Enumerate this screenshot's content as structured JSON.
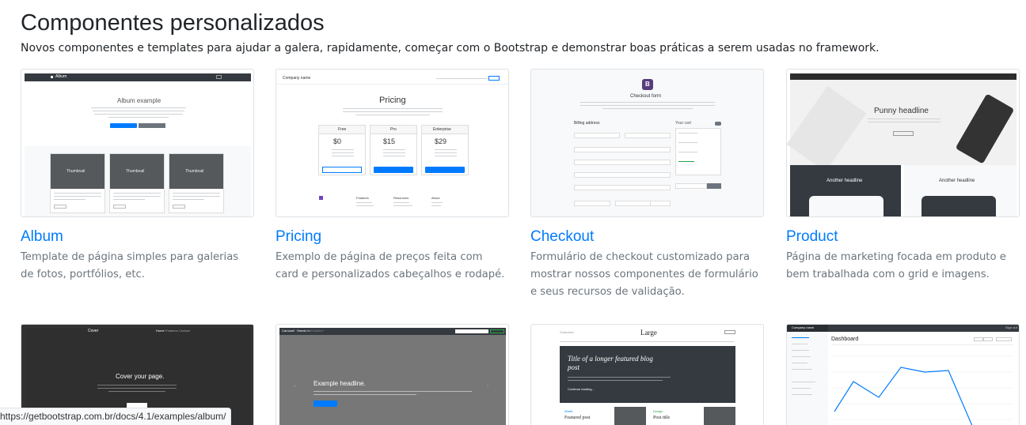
{
  "section": {
    "title": "Componentes personalizados",
    "lead": "Novos componentes e templates para ajudar a galera, rapidamente, começar com o Bootstrap e demonstrar boas práticas a serem usadas no framework."
  },
  "examples": [
    {
      "title": "Album",
      "description": "Template de página simples para galerias de fotos, portfólios, etc."
    },
    {
      "title": "Pricing",
      "description": "Exemplo de página de preços feita com card e personalizados cabeçalhos e rodapé."
    },
    {
      "title": "Checkout",
      "description": "Formulário de checkout customizado para mostrar nossos componentes de formulário e seus recursos de validação."
    },
    {
      "title": "Product",
      "description": "Página de marketing focada em produto e bem trabalhada com o grid e imagens."
    }
  ],
  "thumbs": {
    "album": {
      "brand": "Album",
      "heading": "Album example",
      "thumb_label": "Thumbnail"
    },
    "pricing": {
      "company": "Company name",
      "heading": "Pricing",
      "plans": [
        {
          "name": "Free",
          "price": "$0",
          "per": "/ mo",
          "cta": "Sign up for free"
        },
        {
          "name": "Pro",
          "price": "$15",
          "per": "/ mo",
          "cta": "Get started"
        },
        {
          "name": "Enterprise",
          "price": "$29",
          "per": "/ mo",
          "cta": "Contact us"
        }
      ],
      "footer": [
        "Features",
        "Resources",
        "About"
      ]
    },
    "checkout": {
      "logo": "B",
      "heading": "Checkout form",
      "billing": "Billing address",
      "cart": "Your cart",
      "cart_count": "3"
    },
    "product": {
      "heading": "Punny headline",
      "headline_left": "Another headline",
      "headline_right": "Another headline"
    },
    "cover": {
      "brand": "Cover",
      "nav": [
        "Home",
        "Features",
        "Contact"
      ],
      "heading": "Cover your page.",
      "cta": "Learn more"
    },
    "carousel": {
      "brand": "Carousel",
      "nav": [
        "Home",
        "Link",
        "Disabled"
      ],
      "heading": "Example headline.",
      "cta": "Sign up today",
      "search": "Search"
    },
    "blog": {
      "logo": "Large",
      "subscribe": "Subscribe",
      "signup": "Sign up",
      "feature_title": "Title of a longer featured blog post",
      "continue": "Continue reading...",
      "category_a": "World",
      "post_a": "Featured post",
      "category_b": "Design",
      "post_b": "Post title"
    },
    "dashboard": {
      "company": "Company name",
      "signout": "Sign out",
      "heading": "Dashboard",
      "buttons": [
        "Share",
        "Export",
        "This week"
      ]
    }
  },
  "status_url": "https://getbootstrap.com.br/docs/4.1/examples/album/",
  "colors": {
    "link": "#007bff",
    "muted": "#6c757d",
    "dark": "#343a40"
  }
}
